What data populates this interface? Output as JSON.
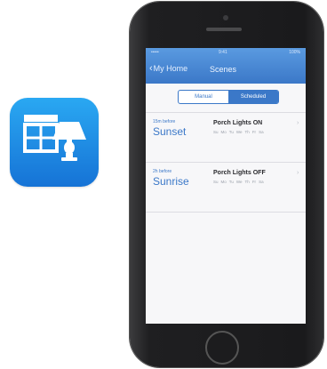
{
  "app_icon": {
    "name": "window-lamp-icon"
  },
  "status_bar": {
    "carrier": "•••••",
    "time": "9:41",
    "battery": "100%"
  },
  "nav": {
    "back_label": "My Home",
    "title": "Scenes"
  },
  "segmented": {
    "options": [
      "Manual",
      "Scheduled"
    ],
    "selected": "Scheduled"
  },
  "schedules": [
    {
      "offset": "15m before",
      "event": "Sunset",
      "scene": "Porch Lights ON",
      "days": [
        "Su",
        "Mo",
        "Tu",
        "We",
        "Th",
        "Fr",
        "Sa"
      ]
    },
    {
      "offset": "2h before",
      "event": "Sunrise",
      "scene": "Porch Lights OFF",
      "days": [
        "Su",
        "Mo",
        "Tu",
        "We",
        "Th",
        "Fr",
        "Sa"
      ]
    }
  ],
  "colors": {
    "accent": "#3b78c8",
    "icon_top": "#2aa8f2",
    "icon_bottom": "#1673d6"
  }
}
